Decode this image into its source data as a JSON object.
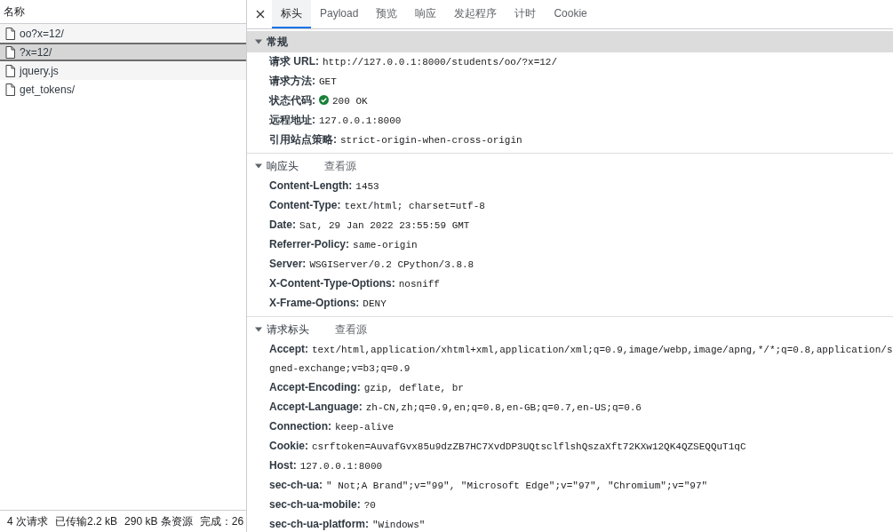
{
  "file_list": {
    "column_header": "名称",
    "items": [
      {
        "name": "oo?x=12/",
        "selected": false
      },
      {
        "name": "?x=12/",
        "selected": true
      },
      {
        "name": "jquery.js",
        "selected": false
      },
      {
        "name": "get_tokens/",
        "selected": false
      }
    ]
  },
  "status_bar": [
    "4 次请求",
    "已传输2.2 kB",
    "290 kB 条资源",
    "完成：26"
  ],
  "tabs": [
    {
      "label": "标头",
      "selected": true
    },
    {
      "label": "Payload",
      "selected": false
    },
    {
      "label": "预览",
      "selected": false
    },
    {
      "label": "响应",
      "selected": false
    },
    {
      "label": "发起程序",
      "selected": false
    },
    {
      "label": "计时",
      "selected": false
    },
    {
      "label": "Cookie",
      "selected": false
    }
  ],
  "sections": [
    {
      "title": "常规",
      "expanded": true,
      "focused": true,
      "rows": [
        {
          "label": "请求 URL:",
          "value": "http://127.0.0.1:8000/students/oo/?x=12/"
        },
        {
          "label": "请求方法:",
          "value": "GET"
        },
        {
          "label": "状态代码:",
          "value": "200 OK",
          "kind": "status"
        },
        {
          "label": "远程地址:",
          "value": "127.0.0.1:8000"
        },
        {
          "label": "引用站点策略:",
          "value": "strict-origin-when-cross-origin"
        }
      ]
    },
    {
      "title": "响应头",
      "link": "查看源",
      "expanded": true,
      "focused": false,
      "rows": [
        {
          "label": "Content-Length:",
          "value": "1453"
        },
        {
          "label": "Content-Type:",
          "value": "text/html; charset=utf-8"
        },
        {
          "label": "Date:",
          "value": "Sat, 29 Jan 2022 23:55:59 GMT"
        },
        {
          "label": "Referrer-Policy:",
          "value": "same-origin"
        },
        {
          "label": "Server:",
          "value": "WSGIServer/0.2 CPython/3.8.8"
        },
        {
          "label": "X-Content-Type-Options:",
          "value": "nosniff"
        },
        {
          "label": "X-Frame-Options:",
          "value": "DENY"
        }
      ]
    },
    {
      "title": "请求标头",
      "link": "查看源",
      "expanded": true,
      "focused": false,
      "rows": [
        {
          "label": "Accept:",
          "value": "text/html,application/xhtml+xml,application/xml;q=0.9,image/webp,image/apng,*/*;q=0.8,application/s",
          "continuation": "gned-exchange;v=b3;q=0.9"
        },
        {
          "label": "Accept-Encoding:",
          "value": "gzip, deflate, br"
        },
        {
          "label": "Accept-Language:",
          "value": "zh-CN,zh;q=0.9,en;q=0.8,en-GB;q=0.7,en-US;q=0.6"
        },
        {
          "label": "Connection:",
          "value": "keep-alive"
        },
        {
          "label": "Cookie:",
          "value": "csrftoken=AuvafGvx85u9dzZB7HC7XvdDP3UQtsclflshQszaXft72KXw12QK4QZSEQQuT1qC"
        },
        {
          "label": "Host:",
          "value": "127.0.0.1:8000"
        },
        {
          "label": "sec-ch-ua:",
          "value": "\" Not;A Brand\";v=\"99\", \"Microsoft Edge\";v=\"97\", \"Chromium\";v=\"97\""
        },
        {
          "label": "sec-ch-ua-mobile:",
          "value": "?0"
        },
        {
          "label": "sec-ch-ua-platform:",
          "value": "\"Windows\""
        }
      ]
    }
  ]
}
